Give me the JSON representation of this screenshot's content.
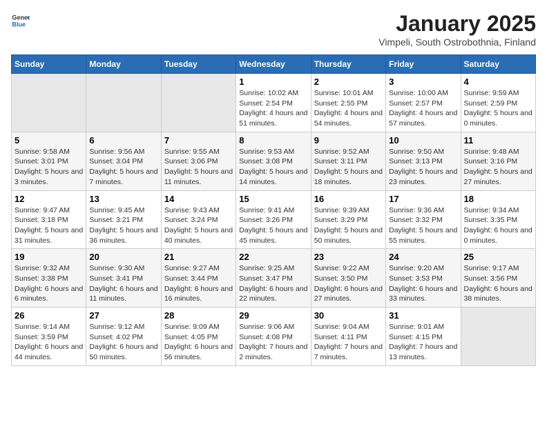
{
  "logo": {
    "text_general": "General",
    "text_blue": "Blue"
  },
  "title": "January 2025",
  "subtitle": "Vimpeli, South Ostrobothnia, Finland",
  "weekdays": [
    "Sunday",
    "Monday",
    "Tuesday",
    "Wednesday",
    "Thursday",
    "Friday",
    "Saturday"
  ],
  "weeks": [
    [
      {
        "day": "",
        "info": ""
      },
      {
        "day": "",
        "info": ""
      },
      {
        "day": "",
        "info": ""
      },
      {
        "day": "1",
        "info": "Sunrise: 10:02 AM\nSunset: 2:54 PM\nDaylight: 4 hours and 51 minutes."
      },
      {
        "day": "2",
        "info": "Sunrise: 10:01 AM\nSunset: 2:55 PM\nDaylight: 4 hours and 54 minutes."
      },
      {
        "day": "3",
        "info": "Sunrise: 10:00 AM\nSunset: 2:57 PM\nDaylight: 4 hours and 57 minutes."
      },
      {
        "day": "4",
        "info": "Sunrise: 9:59 AM\nSunset: 2:59 PM\nDaylight: 5 hours and 0 minutes."
      }
    ],
    [
      {
        "day": "5",
        "info": "Sunrise: 9:58 AM\nSunset: 3:01 PM\nDaylight: 5 hours and 3 minutes."
      },
      {
        "day": "6",
        "info": "Sunrise: 9:56 AM\nSunset: 3:04 PM\nDaylight: 5 hours and 7 minutes."
      },
      {
        "day": "7",
        "info": "Sunrise: 9:55 AM\nSunset: 3:06 PM\nDaylight: 5 hours and 11 minutes."
      },
      {
        "day": "8",
        "info": "Sunrise: 9:53 AM\nSunset: 3:08 PM\nDaylight: 5 hours and 14 minutes."
      },
      {
        "day": "9",
        "info": "Sunrise: 9:52 AM\nSunset: 3:11 PM\nDaylight: 5 hours and 18 minutes."
      },
      {
        "day": "10",
        "info": "Sunrise: 9:50 AM\nSunset: 3:13 PM\nDaylight: 5 hours and 23 minutes."
      },
      {
        "day": "11",
        "info": "Sunrise: 9:48 AM\nSunset: 3:16 PM\nDaylight: 5 hours and 27 minutes."
      }
    ],
    [
      {
        "day": "12",
        "info": "Sunrise: 9:47 AM\nSunset: 3:18 PM\nDaylight: 5 hours and 31 minutes."
      },
      {
        "day": "13",
        "info": "Sunrise: 9:45 AM\nSunset: 3:21 PM\nDaylight: 5 hours and 36 minutes."
      },
      {
        "day": "14",
        "info": "Sunrise: 9:43 AM\nSunset: 3:24 PM\nDaylight: 5 hours and 40 minutes."
      },
      {
        "day": "15",
        "info": "Sunrise: 9:41 AM\nSunset: 3:26 PM\nDaylight: 5 hours and 45 minutes."
      },
      {
        "day": "16",
        "info": "Sunrise: 9:39 AM\nSunset: 3:29 PM\nDaylight: 5 hours and 50 minutes."
      },
      {
        "day": "17",
        "info": "Sunrise: 9:36 AM\nSunset: 3:32 PM\nDaylight: 5 hours and 55 minutes."
      },
      {
        "day": "18",
        "info": "Sunrise: 9:34 AM\nSunset: 3:35 PM\nDaylight: 6 hours and 0 minutes."
      }
    ],
    [
      {
        "day": "19",
        "info": "Sunrise: 9:32 AM\nSunset: 3:38 PM\nDaylight: 6 hours and 6 minutes."
      },
      {
        "day": "20",
        "info": "Sunrise: 9:30 AM\nSunset: 3:41 PM\nDaylight: 6 hours and 11 minutes."
      },
      {
        "day": "21",
        "info": "Sunrise: 9:27 AM\nSunset: 3:44 PM\nDaylight: 6 hours and 16 minutes."
      },
      {
        "day": "22",
        "info": "Sunrise: 9:25 AM\nSunset: 3:47 PM\nDaylight: 6 hours and 22 minutes."
      },
      {
        "day": "23",
        "info": "Sunrise: 9:22 AM\nSunset: 3:50 PM\nDaylight: 6 hours and 27 minutes."
      },
      {
        "day": "24",
        "info": "Sunrise: 9:20 AM\nSunset: 3:53 PM\nDaylight: 6 hours and 33 minutes."
      },
      {
        "day": "25",
        "info": "Sunrise: 9:17 AM\nSunset: 3:56 PM\nDaylight: 6 hours and 38 minutes."
      }
    ],
    [
      {
        "day": "26",
        "info": "Sunrise: 9:14 AM\nSunset: 3:59 PM\nDaylight: 6 hours and 44 minutes."
      },
      {
        "day": "27",
        "info": "Sunrise: 9:12 AM\nSunset: 4:02 PM\nDaylight: 6 hours and 50 minutes."
      },
      {
        "day": "28",
        "info": "Sunrise: 9:09 AM\nSunset: 4:05 PM\nDaylight: 6 hours and 56 minutes."
      },
      {
        "day": "29",
        "info": "Sunrise: 9:06 AM\nSunset: 4:08 PM\nDaylight: 7 hours and 2 minutes."
      },
      {
        "day": "30",
        "info": "Sunrise: 9:04 AM\nSunset: 4:11 PM\nDaylight: 7 hours and 7 minutes."
      },
      {
        "day": "31",
        "info": "Sunrise: 9:01 AM\nSunset: 4:15 PM\nDaylight: 7 hours and 13 minutes."
      },
      {
        "day": "",
        "info": ""
      }
    ]
  ]
}
